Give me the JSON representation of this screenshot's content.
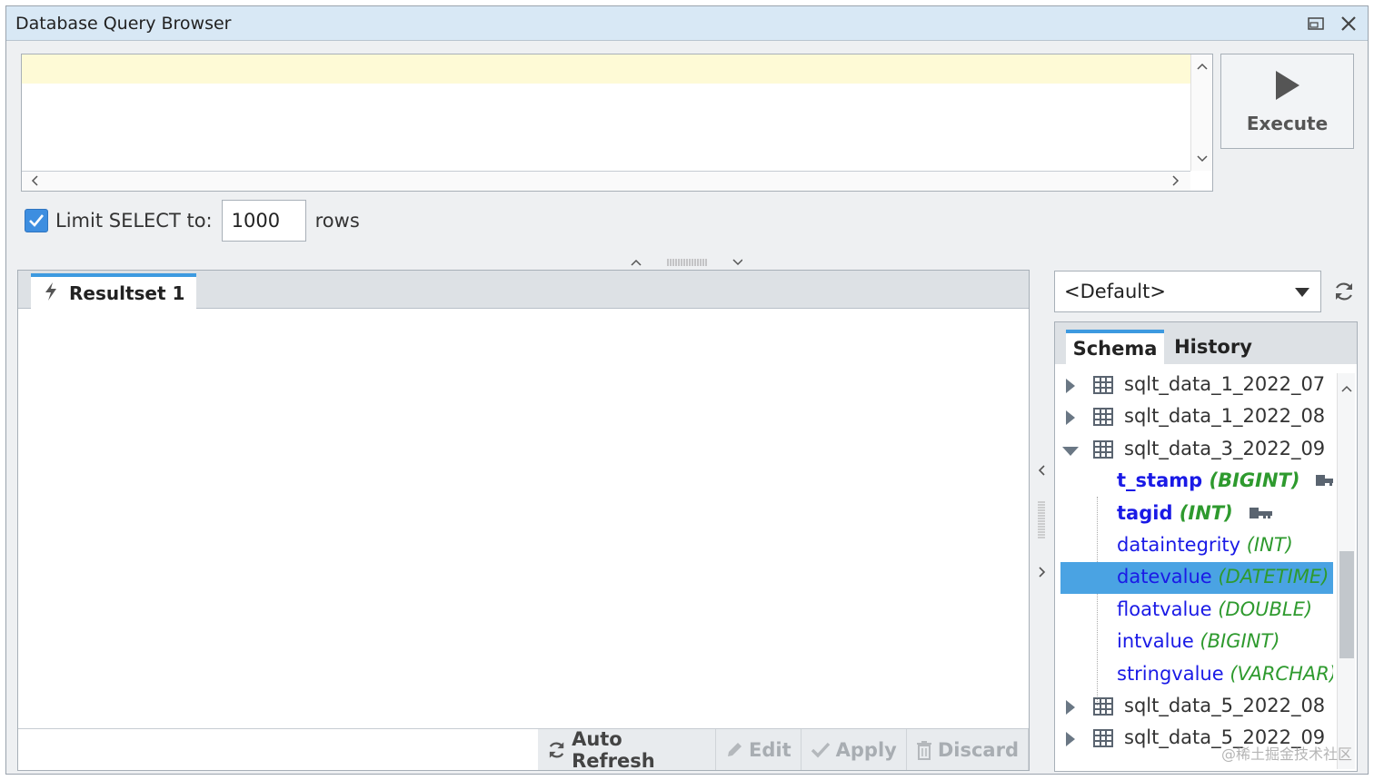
{
  "window": {
    "title": "Database Query Browser",
    "restore_icon": "restore-window-icon",
    "close_icon": "close-icon"
  },
  "editor": {
    "query_text": ""
  },
  "execute": {
    "label": "Execute",
    "icon": "play-icon"
  },
  "limit": {
    "checked": true,
    "label": "Limit SELECT to:",
    "value": "1000",
    "suffix": "rows"
  },
  "results": {
    "tabs": [
      {
        "label": "Resultset 1",
        "icon": "lightning-icon"
      }
    ],
    "toolbar": {
      "auto_refresh": "Auto Refresh",
      "edit": "Edit",
      "apply": "Apply",
      "discard": "Discard"
    }
  },
  "datasource": {
    "selected": "<Default>"
  },
  "browser": {
    "tabs": [
      "Schema",
      "History"
    ],
    "active_tab": "Schema",
    "tree": [
      {
        "kind": "table",
        "name": "sqlt_data_1_2022_07",
        "expanded": false
      },
      {
        "kind": "table",
        "name": "sqlt_data_1_2022_08",
        "expanded": false
      },
      {
        "kind": "table",
        "name": "sqlt_data_3_2022_09",
        "expanded": true
      },
      {
        "kind": "column",
        "name": "t_stamp",
        "type": "(BIGINT)",
        "primary_key": true
      },
      {
        "kind": "column",
        "name": "tagid",
        "type": "(INT)",
        "primary_key": true
      },
      {
        "kind": "column",
        "name": "dataintegrity",
        "type": "(INT)",
        "primary_key": false
      },
      {
        "kind": "column",
        "name": "datevalue",
        "type": "(DATETIME)",
        "primary_key": false,
        "selected": true
      },
      {
        "kind": "column",
        "name": "floatvalue",
        "type": "(DOUBLE)",
        "primary_key": false
      },
      {
        "kind": "column",
        "name": "intvalue",
        "type": "(BIGINT)",
        "primary_key": false
      },
      {
        "kind": "column",
        "name": "stringvalue",
        "type": "(VARCHAR)",
        "primary_key": false
      },
      {
        "kind": "table",
        "name": "sqlt_data_5_2022_08",
        "expanded": false
      },
      {
        "kind": "table",
        "name": "sqlt_data_5_2022_09",
        "expanded": false
      }
    ]
  },
  "watermark": "@稀土掘金技术社区",
  "colors": {
    "accent": "#3d9ae0",
    "selection": "#4aa3e3",
    "column_name": "#1a1ae6",
    "column_type": "#2e9a2e",
    "editor_current_line": "#fefad6"
  }
}
